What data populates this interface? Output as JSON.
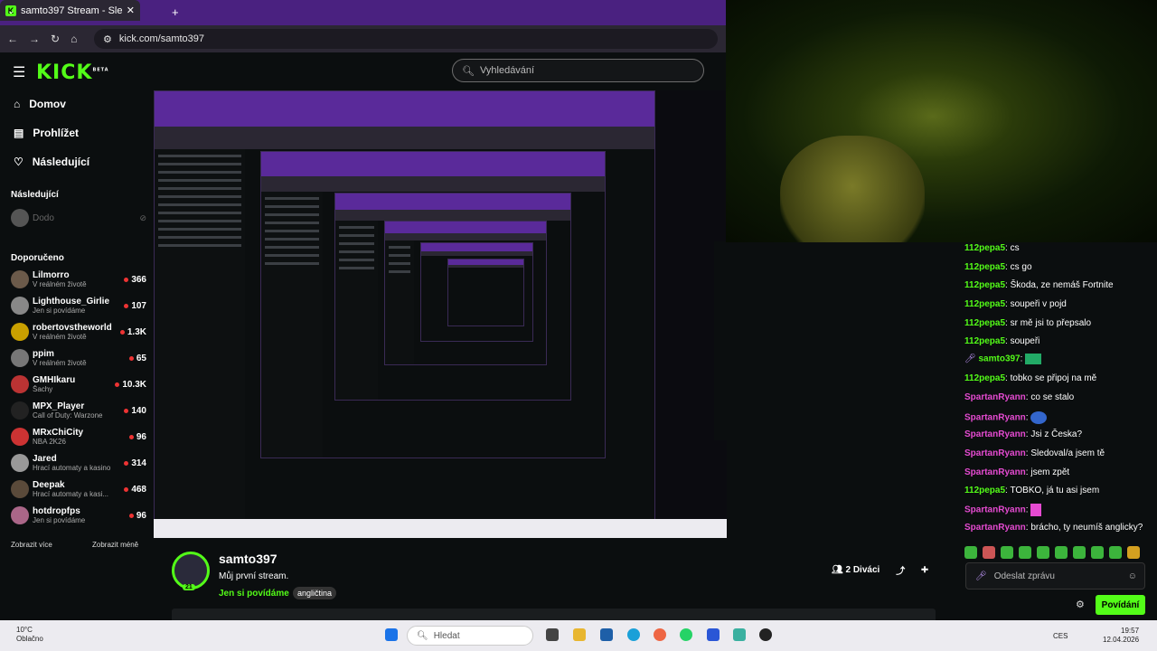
{
  "browser": {
    "tab_title": "samto397 Stream - Sleduj ž…",
    "new_tab": "+",
    "url": "kick.com/samto397"
  },
  "kick": {
    "logo": "KICK",
    "logo_sup": "BETA",
    "search_placeholder": "Vyhledávání"
  },
  "sidebar": {
    "nav": [
      {
        "label": "Domov",
        "icon": "home-icon"
      },
      {
        "label": "Prohlížet",
        "icon": "browse-icon"
      },
      {
        "label": "Následující",
        "icon": "heart-icon"
      }
    ],
    "following_title": "Následující",
    "following": [
      {
        "name": "Dodo"
      }
    ],
    "recommended_title": "Doporučeno",
    "channels": [
      {
        "name": "Lilmorro",
        "category": "V reálném životě",
        "viewers": "366"
      },
      {
        "name": "Lighthouse_Girlie",
        "category": "Jen si povídáme",
        "viewers": "107"
      },
      {
        "name": "robertovstheworld",
        "category": "V reálném životě",
        "viewers": "1.3K"
      },
      {
        "name": "ppim",
        "category": "V reálném životě",
        "viewers": "65"
      },
      {
        "name": "GMHIkaru",
        "category": "Šachy",
        "viewers": "10.3K"
      },
      {
        "name": "MPX_Player",
        "category": "Call of Duty: Warzone",
        "viewers": "140"
      },
      {
        "name": "MRxChiCity",
        "category": "NBA 2K26",
        "viewers": "96"
      },
      {
        "name": "Jared",
        "category": "Hrací automaty a kasino",
        "viewers": "314"
      },
      {
        "name": "Deepak",
        "category": "Hrací automaty a kasi...",
        "viewers": "468"
      },
      {
        "name": "hotdropfps",
        "category": "Jen si povídáme",
        "viewers": "96"
      }
    ],
    "show_more": "Zobrazit více",
    "show_less": "Zobrazit méně"
  },
  "stream": {
    "name": "samto397",
    "title": "Můj první stream.",
    "category": "Jen si povídáme",
    "tag": "angličtina",
    "viewers": "2 Diváci",
    "badge": "21"
  },
  "chat": {
    "messages": [
      {
        "user": "112pepa5",
        "text": "cs",
        "color": "#53fc18"
      },
      {
        "user": "112pepa5",
        "text": "cs go",
        "color": "#53fc18"
      },
      {
        "user": "112pepa5",
        "text": "Škoda, ze nemáš Fortnite",
        "color": "#53fc18"
      },
      {
        "user": "112pepa5",
        "text": "soupeři v pojd",
        "color": "#53fc18"
      },
      {
        "user": "112pepa5",
        "text": "sr mě jsi to přepsalo",
        "color": "#53fc18"
      },
      {
        "user": "112pepa5",
        "text": "soupeři",
        "color": "#53fc18"
      },
      {
        "user": "samto397",
        "text": "",
        "color": "#53fc18"
      },
      {
        "user": "112pepa5",
        "text": "tobko se připoj na mě",
        "color": "#53fc18"
      },
      {
        "user": "SpartanRyann",
        "text": "co se stalo",
        "color": "#e64bd2"
      },
      {
        "user": "SpartanRyann",
        "text": "",
        "color": "#e64bd2"
      },
      {
        "user": "SpartanRyann",
        "text": "Jsi z Česka?",
        "color": "#e64bd2"
      },
      {
        "user": "SpartanRyann",
        "text": "Sledoval/a jsem tě",
        "color": "#e64bd2"
      },
      {
        "user": "SpartanRyann",
        "text": "jsem zpět",
        "color": "#e64bd2"
      },
      {
        "user": "112pepa5",
        "text": "TOBKO, já tu asi jsem",
        "color": "#53fc18"
      },
      {
        "user": "SpartanRyann",
        "text": "",
        "color": "#e64bd2"
      },
      {
        "user": "SpartanRyann",
        "text": "brácho, ty neumíš anglicky?",
        "color": "#e64bd2"
      }
    ],
    "input_placeholder": "Odeslat zprávu",
    "send_label": "Povídání"
  },
  "taskbar": {
    "temp": "10°C",
    "weather": "Oblačno",
    "search": "Hledat",
    "lang": "CES",
    "time": "19:57",
    "date": "12.04.2026"
  },
  "colors": {
    "accent": "#53fc18",
    "chrome": "#4a2180"
  }
}
